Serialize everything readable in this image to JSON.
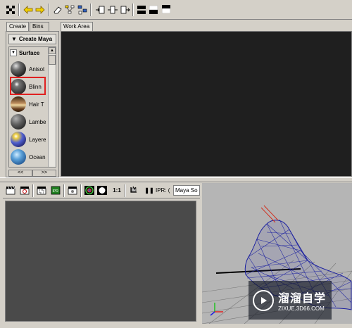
{
  "toolbar": {
    "icons": [
      "checkerboard-icon",
      "arrow-left-icon",
      "arrow-right-icon",
      "eraser-icon",
      "graph-network-icon",
      "graph-select-icon",
      "input-connections-icon",
      "io-connections-icon",
      "output-connections-icon",
      "layout-split-icon",
      "layout-bottom-icon",
      "layout-top-icon"
    ]
  },
  "left_panel": {
    "tabs": [
      "Create",
      "Bins"
    ],
    "create_maya_label": "Create Maya",
    "surface_label": "Surface",
    "swatches": [
      {
        "label": "Anisot",
        "color": "#5a5a5a"
      },
      {
        "label": "Blinn",
        "color": "#4e4e4e",
        "highlight": "#ff3333"
      },
      {
        "label": "Hair T",
        "color": "#7a5530"
      },
      {
        "label": "Lambe",
        "color": "#6a6a6a"
      },
      {
        "label": "Layere",
        "color": "#5a60c0"
      },
      {
        "label": "Ocean",
        "color": "#3b7fb8"
      }
    ],
    "scroll_prev": "<<",
    "scroll_next": ">>"
  },
  "work_area": {
    "tab_label": "Work Area",
    "bg": "#1f1f1f"
  },
  "render_view": {
    "ratio_label": "1:1",
    "ipr_label": "IPR: (",
    "dropdown_value": "Maya So",
    "bg": "#4a4a4a"
  },
  "viewport": {
    "bg": "#b5b5b5",
    "mesh_color": "#1a1fa0"
  },
  "watermark": {
    "brand": "溜溜自学",
    "url": "ZIXUE.3D66.COM"
  }
}
